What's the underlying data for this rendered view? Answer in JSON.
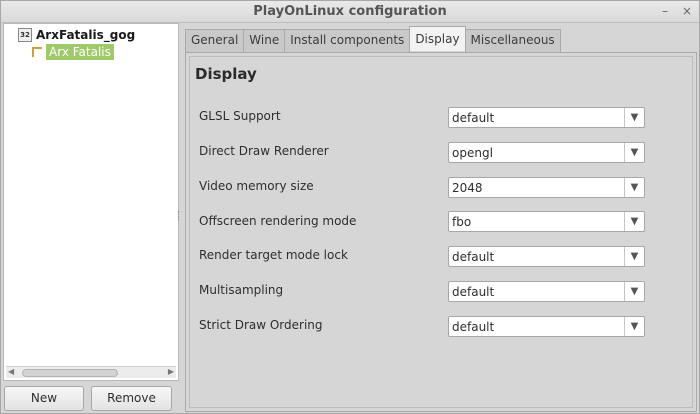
{
  "window": {
    "title": "PlayOnLinux configuration",
    "minimize_glyph": "–",
    "close_glyph": "×"
  },
  "tree": {
    "root": {
      "label": "ArxFatalis_gog",
      "icon_text": "32",
      "icon": "wine-prefix-icon"
    },
    "child": {
      "label": "Arx Fatalis",
      "icon": "shortcut-key-icon",
      "selected": true
    }
  },
  "left_buttons": {
    "new_label": "New",
    "remove_label": "Remove"
  },
  "tabs": [
    {
      "label": "General"
    },
    {
      "label": "Wine"
    },
    {
      "label": "Install components"
    },
    {
      "label": "Display",
      "active": true
    },
    {
      "label": "Miscellaneous"
    }
  ],
  "display": {
    "title": "Display",
    "settings": [
      {
        "label": "GLSL Support",
        "value": "default"
      },
      {
        "label": "Direct Draw Renderer",
        "value": "opengl"
      },
      {
        "label": "Video memory size",
        "value": "2048"
      },
      {
        "label": "Offscreen rendering mode",
        "value": "fbo"
      },
      {
        "label": "Render target mode lock",
        "value": "default"
      },
      {
        "label": "Multisampling",
        "value": "default"
      },
      {
        "label": "Strict Draw Ordering",
        "value": "default"
      }
    ]
  },
  "colors": {
    "selection": "#9fc96a",
    "window_bg": "#d6d6d6"
  }
}
